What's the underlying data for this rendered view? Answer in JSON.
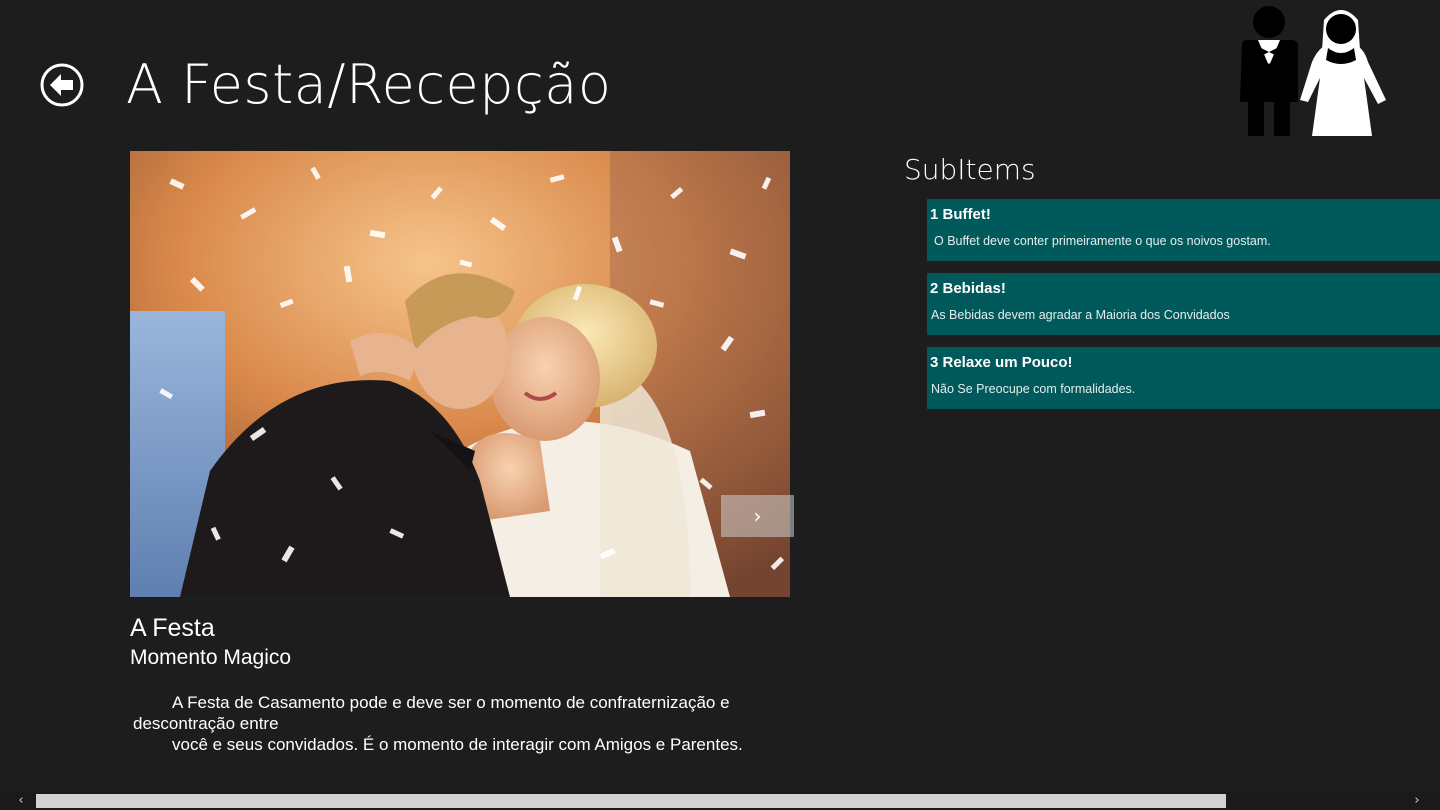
{
  "page": {
    "title": "A Festa/Recepção"
  },
  "item": {
    "title": "A Festa",
    "subtitle": "Momento Magico",
    "description_lines": [
      "A Festa de Casamento pode e deve ser o momento de confraternização e",
      "descontração entre",
      "você e seus convidados. É o momento de interagir com Amigos e Parentes."
    ],
    "flip_next_glyph": "›"
  },
  "subitems": {
    "header": "SubItems",
    "items": [
      {
        "title": "1 Buffet!",
        "description": "O Buffet deve conter primeiramente o que os noivos gostam."
      },
      {
        "title": "2 Bebidas!",
        "description": "As Bebidas devem agradar a Maioria dos Convidados"
      },
      {
        "title": "3 Relaxe um Pouco!",
        "description": "Não Se Preocupe com formalidades."
      }
    ]
  },
  "icons": {
    "back": "back-arrow-icon",
    "logo": "bride-groom-icon",
    "scroll_left": "‹",
    "scroll_right": "›"
  },
  "colors": {
    "background": "#1d1d1d",
    "tile": "#005a5c",
    "text": "#ffffff"
  }
}
